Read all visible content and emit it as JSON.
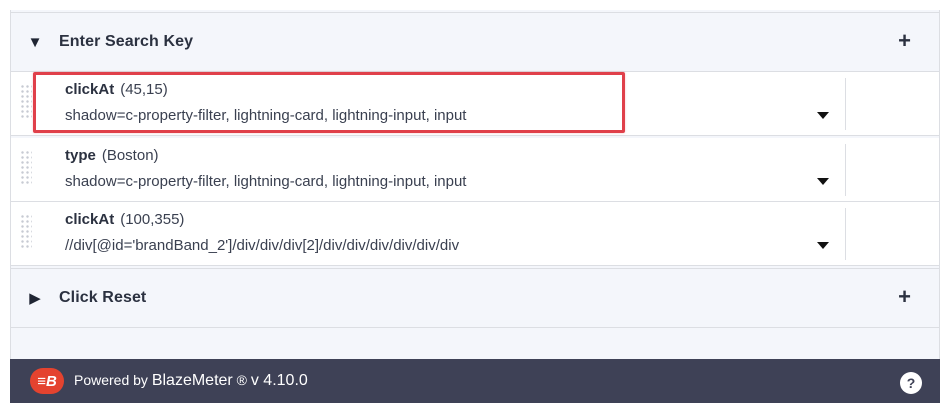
{
  "groups": [
    {
      "title": "Enter Search Key",
      "caret": "▼",
      "add": "+"
    },
    {
      "title": "Click Reset",
      "caret": "▶",
      "add": "+"
    }
  ],
  "steps": [
    {
      "command": "clickAt",
      "value": "(45,15)",
      "target": "shadow=c-property-filter, lightning-card, lightning-input, input",
      "highlighted": true
    },
    {
      "command": "type",
      "value": "(Boston)",
      "target": "shadow=c-property-filter, lightning-card, lightning-input, input",
      "highlighted": false
    },
    {
      "command": "clickAt",
      "value": "(100,355)",
      "target": "//div[@id='brandBand_2']/div/div/div[2]/div/div/div/div/div/div",
      "highlighted": false
    }
  ],
  "footer": {
    "logo_text": "≡B",
    "powered_by": "Powered by",
    "brand": "BlazeMeter",
    "registered": "®",
    "version": "v 4.10.0",
    "help": "?"
  },
  "colors": {
    "highlight": "#e0404a",
    "footer_bg": "#3e4156",
    "logo_bg": "#e4432f"
  }
}
